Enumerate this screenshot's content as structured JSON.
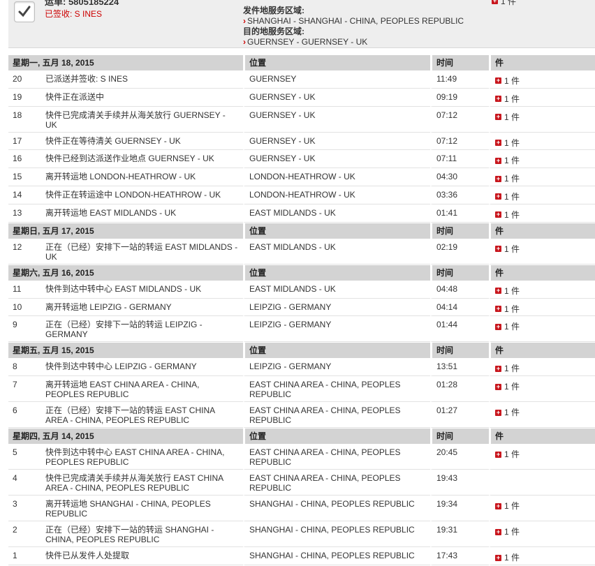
{
  "summary": {
    "waybill": "运单: 5805185224",
    "signed": "已签收: S INES",
    "origin_label": "发件地服务区域:",
    "origin_value": "SHANGHAI - SHANGHAI - CHINA, PEOPLES REPUBLIC",
    "dest_label": "目的地服务区域:",
    "dest_value": "GUERNSEY - GUERNSEY - UK",
    "pieces": "1 件"
  },
  "columns": {
    "location": "位置",
    "time": "时间",
    "pieces": "件"
  },
  "days": [
    {
      "date": "星期一, 五月 18, 2015",
      "events": [
        {
          "num": "20",
          "desc": "已派送并签收: S INES",
          "loc": "GUERNSEY",
          "time": "11:49",
          "pieces": "1 件"
        },
        {
          "num": "19",
          "desc": "快件正在派送中",
          "loc": "GUERNSEY - UK",
          "time": "09:19",
          "pieces": "1 件"
        },
        {
          "num": "18",
          "desc": "快件已完成清关手续并从海关放行 GUERNSEY - UK",
          "loc": "GUERNSEY - UK",
          "time": "07:12",
          "pieces": "1 件"
        },
        {
          "num": "17",
          "desc": "快件正在等待清关 GUERNSEY - UK",
          "loc": "GUERNSEY - UK",
          "time": "07:12",
          "pieces": "1 件"
        },
        {
          "num": "16",
          "desc": "快件已经到达派送作业地点 GUERNSEY - UK",
          "loc": "GUERNSEY - UK",
          "time": "07:11",
          "pieces": "1 件"
        },
        {
          "num": "15",
          "desc": "离开转运地 LONDON-HEATHROW - UK",
          "loc": "LONDON-HEATHROW - UK",
          "time": "04:30",
          "pieces": "1 件"
        },
        {
          "num": "14",
          "desc": "快件正在转运途中 LONDON-HEATHROW - UK",
          "loc": "LONDON-HEATHROW - UK",
          "time": "03:36",
          "pieces": "1 件"
        },
        {
          "num": "13",
          "desc": "离开转运地 EAST MIDLANDS - UK",
          "loc": "EAST MIDLANDS - UK",
          "time": "01:41",
          "pieces": "1 件"
        }
      ]
    },
    {
      "date": "星期日, 五月 17, 2015",
      "events": [
        {
          "num": "12",
          "desc": "正在（已经）安排下一站的转运 EAST MIDLANDS - UK",
          "loc": "EAST MIDLANDS - UK",
          "time": "02:19",
          "pieces": "1 件"
        }
      ]
    },
    {
      "date": "星期六, 五月 16, 2015",
      "events": [
        {
          "num": "11",
          "desc": "快件到达中转中心 EAST MIDLANDS - UK",
          "loc": "EAST MIDLANDS - UK",
          "time": "04:48",
          "pieces": "1 件"
        },
        {
          "num": "10",
          "desc": "离开转运地 LEIPZIG - GERMANY",
          "loc": "LEIPZIG - GERMANY",
          "time": "04:14",
          "pieces": "1 件"
        },
        {
          "num": "9",
          "desc": "正在（已经）安排下一站的转运 LEIPZIG - GERMANY",
          "loc": "LEIPZIG - GERMANY",
          "time": "01:44",
          "pieces": "1 件"
        }
      ]
    },
    {
      "date": "星期五, 五月 15, 2015",
      "events": [
        {
          "num": "8",
          "desc": "快件到达中转中心 LEIPZIG - GERMANY",
          "loc": "LEIPZIG - GERMANY",
          "time": "13:51",
          "pieces": "1 件"
        },
        {
          "num": "7",
          "desc": "离开转运地 EAST CHINA AREA - CHINA, PEOPLES REPUBLIC",
          "loc": "EAST CHINA AREA - CHINA, PEOPLES REPUBLIC",
          "time": "01:28",
          "pieces": "1 件"
        },
        {
          "num": "6",
          "desc": "正在（已经）安排下一站的转运 EAST CHINA AREA - CHINA, PEOPLES REPUBLIC",
          "loc": "EAST CHINA AREA - CHINA, PEOPLES REPUBLIC",
          "time": "01:27",
          "pieces": "1 件"
        }
      ]
    },
    {
      "date": "星期四, 五月 14, 2015",
      "events": [
        {
          "num": "5",
          "desc": "快件到达中转中心 EAST CHINA AREA - CHINA, PEOPLES REPUBLIC",
          "loc": "EAST CHINA AREA - CHINA, PEOPLES REPUBLIC",
          "time": "20:45",
          "pieces": "1 件"
        },
        {
          "num": "4",
          "desc": "快件已完成清关手续并从海关放行 EAST CHINA AREA - CHINA, PEOPLES REPUBLIC",
          "loc": "EAST CHINA AREA - CHINA, PEOPLES REPUBLIC",
          "time": "19:43",
          "pieces": ""
        },
        {
          "num": "3",
          "desc": "离开转运地 SHANGHAI - CHINA, PEOPLES REPUBLIC",
          "loc": "SHANGHAI - CHINA, PEOPLES REPUBLIC",
          "time": "19:34",
          "pieces": "1 件"
        },
        {
          "num": "2",
          "desc": "正在（已经）安排下一站的转运 SHANGHAI - CHINA, PEOPLES REPUBLIC",
          "loc": "SHANGHAI - CHINA, PEOPLES REPUBLIC",
          "time": "19:31",
          "pieces": "1 件"
        },
        {
          "num": "1",
          "desc": "快件已从发件人处提取",
          "loc": "SHANGHAI - CHINA, PEOPLES REPUBLIC",
          "time": "17:43",
          "pieces": "1 件"
        }
      ]
    }
  ]
}
